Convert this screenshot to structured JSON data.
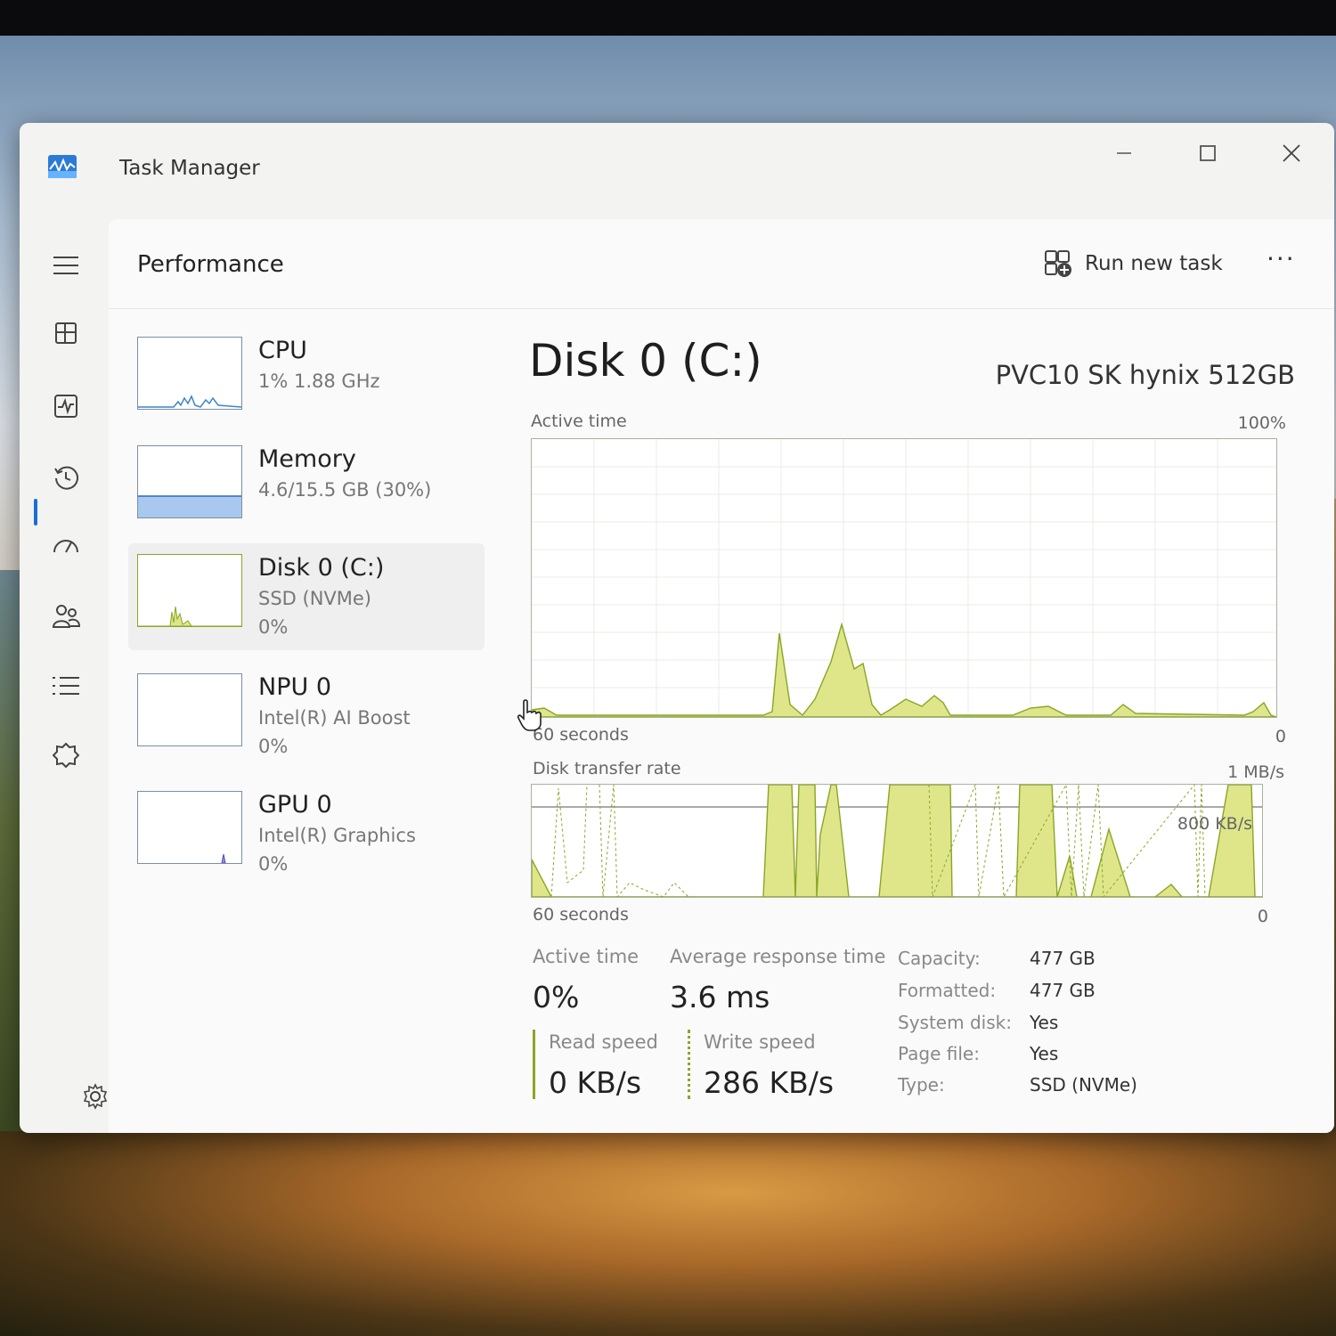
{
  "window": {
    "title": "Task Manager"
  },
  "nav": {
    "items": [
      "menu-icon",
      "processes-icon",
      "performance-icon",
      "app-history-icon",
      "startup-apps-icon",
      "users-icon",
      "details-icon",
      "services-icon"
    ],
    "active": "performance-icon",
    "settings": "settings-icon"
  },
  "header": {
    "title": "Performance",
    "run_new_task": "Run new task",
    "more": "···"
  },
  "devices": [
    {
      "name": "CPU",
      "sub1": "1%  1.88 GHz",
      "sub2": ""
    },
    {
      "name": "Memory",
      "sub1": "4.6/15.5 GB (30%)",
      "sub2": ""
    },
    {
      "name": "Disk 0 (C:)",
      "sub1": "SSD (NVMe)",
      "sub2": "0%"
    },
    {
      "name": "NPU 0",
      "sub1": "Intel(R) AI Boost",
      "sub2": "0%"
    },
    {
      "name": "GPU 0",
      "sub1": "Intel(R) Graphics",
      "sub2": "0%"
    }
  ],
  "detail": {
    "title": "Disk 0 (C:)",
    "model": "PVC10 SK hynix 512GB",
    "active_graph": {
      "label": "Active time",
      "max": "100%",
      "span": "60 seconds",
      "min": "0"
    },
    "transfer_graph": {
      "label": "Disk transfer rate",
      "max": "1 MB/s",
      "mid": "800 KB/s",
      "span": "60 seconds",
      "min": "0"
    },
    "stats": {
      "active_time_label": "Active time",
      "active_time": "0%",
      "avg_response_label": "Average response time",
      "avg_response": "3.6 ms",
      "read_label": "Read speed",
      "read": "0 KB/s",
      "write_label": "Write speed",
      "write": "286 KB/s"
    },
    "props": [
      {
        "k": "Capacity:",
        "v": "477 GB"
      },
      {
        "k": "Formatted:",
        "v": "477 GB"
      },
      {
        "k": "System disk:",
        "v": "Yes"
      },
      {
        "k": "Page file:",
        "v": "Yes"
      },
      {
        "k": "Type:",
        "v": "SSD (NVMe)"
      }
    ]
  },
  "colors": {
    "accent": "#1a6fd6",
    "disk_fill": "#dfe68a",
    "disk_line": "#8aa624",
    "mem_fill": "#a9c8ee"
  }
}
